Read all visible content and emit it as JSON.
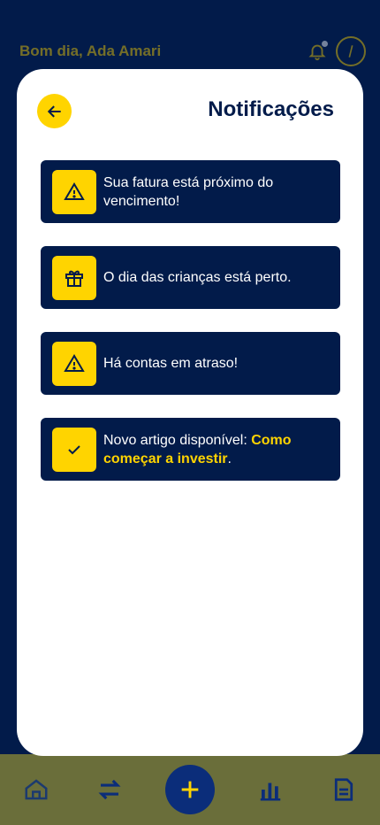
{
  "header": {
    "greeting": "Bom dia, Ada Amari",
    "icons": [
      "bell-icon",
      "user-icon"
    ]
  },
  "modal": {
    "title": "Notificações",
    "back_icon": "arrow-left-icon"
  },
  "notifications": [
    {
      "icon": "warning-icon",
      "text": "Sua fatura está próximo do vencimento!"
    },
    {
      "icon": "gift-icon",
      "text": "O dia das crianças está perto."
    },
    {
      "icon": "warning-icon",
      "text": "Há contas em atraso!"
    },
    {
      "icon": "check-icon",
      "text_prefix": "Novo artigo disponível: ",
      "link_text": "Como começar a investir",
      "text_suffix": "."
    }
  ],
  "bottom_nav": {
    "items": [
      "home-icon",
      "transfer-icon",
      "add-icon",
      "chart-icon",
      "document-icon"
    ]
  },
  "colors": {
    "navy": "#021b4a",
    "yellow": "#ffd400",
    "white": "#ffffff"
  }
}
